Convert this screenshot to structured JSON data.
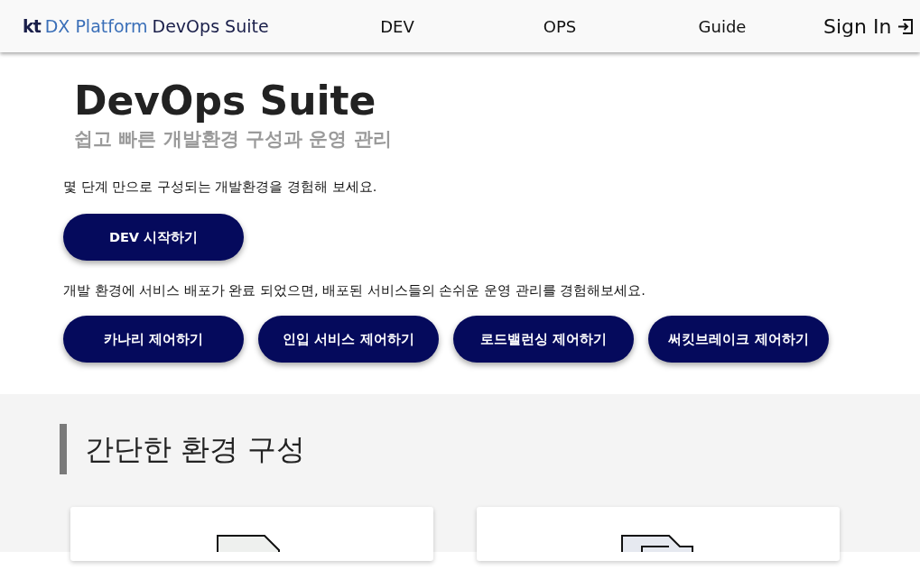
{
  "header": {
    "logo_mark": "kt",
    "logo_brand": "DX Platform",
    "logo_product": "DevOps Suite",
    "nav": [
      {
        "label": "DEV"
      },
      {
        "label": "OPS"
      },
      {
        "label": "Guide"
      }
    ],
    "sign_in": "Sign In"
  },
  "hero": {
    "title": "DevOps Suite",
    "subtitle": "쉽고 빠른 개발환경 구성과 운영 관리",
    "dev_text": "몇 단계 만으로 구성되는 개발환경을 경험해 보세요.",
    "dev_buttons": [
      "DEV 시작하기"
    ],
    "ops_text": "개발 환경에 서비스 배포가 완료 되었으면, 배포된 서비스들의 손쉬운 운영 관리를 경험해보세요.",
    "ops_buttons": [
      "카나리 제어하기",
      "인입 서비스 제어하기",
      "로드밸런싱 제어하기",
      "써킷브레이크 제어하기"
    ]
  },
  "section": {
    "heading": "간단한 환경 구성",
    "cards": [
      {
        "kind": "document"
      },
      {
        "kind": "documents"
      }
    ]
  }
}
